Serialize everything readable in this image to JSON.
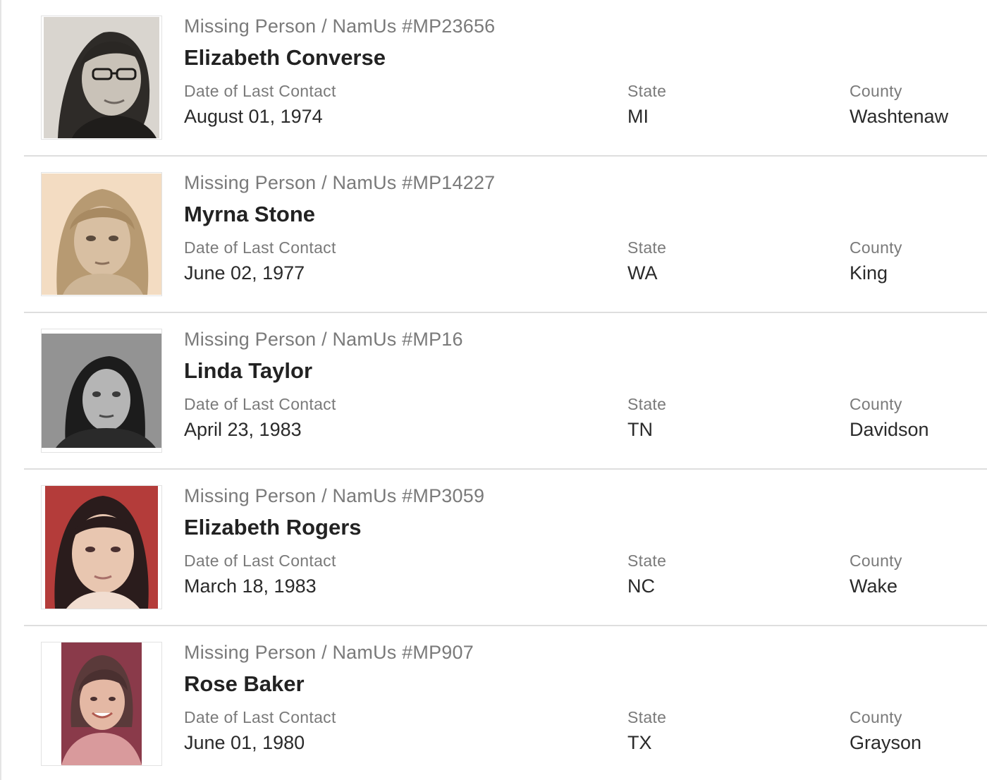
{
  "labels": {
    "date": "Date of Last Contact",
    "state": "State",
    "county": "County"
  },
  "cases": [
    {
      "caption": "Missing Person / NamUs #MP23656",
      "name": "Elizabeth Converse",
      "date": "August 01, 1974",
      "state": "MI",
      "county": "Washtenaw",
      "photo": "black-and-white-portrait"
    },
    {
      "caption": "Missing Person / NamUs #MP14227",
      "name": "Myrna Stone",
      "date": "June 02, 1977",
      "state": "WA",
      "county": "King",
      "photo": "sepia-portrait"
    },
    {
      "caption": "Missing Person / NamUs #MP16",
      "name": "Linda Taylor",
      "date": "April 23, 1983",
      "state": "TN",
      "county": "Davidson",
      "photo": "grainy-grayscale-portrait"
    },
    {
      "caption": "Missing Person / NamUs #MP3059",
      "name": "Elizabeth Rogers",
      "date": "March 18, 1983",
      "state": "NC",
      "county": "Wake",
      "photo": "color-portrait"
    },
    {
      "caption": "Missing Person / NamUs #MP907",
      "name": "Rose Baker",
      "date": "June 01, 1980",
      "state": "TX",
      "county": "Grayson",
      "photo": "color-portrait"
    }
  ],
  "colors": {
    "caption": "#7a7a7a",
    "name": "#222222",
    "divider": "#dedede"
  }
}
